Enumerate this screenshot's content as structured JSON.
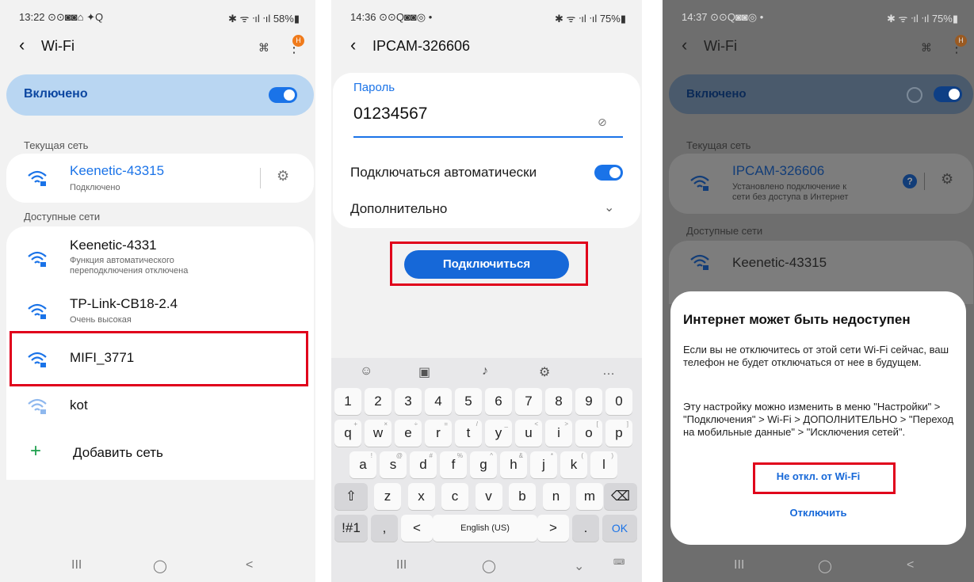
{
  "panel1": {
    "status_time": "13:22 ⊙⊙◙◙⌂ ✦Q",
    "status_right": "✱ ᯤ ᐧıl ᐧıl 58%▮",
    "title": "Wi-Fi",
    "badge": "Н",
    "toggle_label": "Включено",
    "current_section": "Текущая сеть",
    "current_network": {
      "name": "Keenetic-43315",
      "status": "Подключено"
    },
    "available_section": "Доступные сети",
    "networks": [
      {
        "name": "Keenetic-4331",
        "sub": "Функция автоматического\nпереподключения отключена"
      },
      {
        "name": "TP-Link-CB18-2.4",
        "sub": "Очень высокая"
      },
      {
        "name": "MIFI_3771",
        "sub": ""
      },
      {
        "name": "kot",
        "sub": ""
      }
    ],
    "add_network": "Добавить сеть",
    "accent": "#1a73e8",
    "highlight": "#e0001b"
  },
  "panel2": {
    "status_time": "14:36 ⊙⊙Q◙◙◎ •",
    "status_right": "✱ ᯤ ᐧıl ᐧıl 75%▮",
    "title": "IPCAM-326606",
    "password_label": "Пароль",
    "password_value": "01234567",
    "auto_connect": "Подключаться автоматически",
    "advanced": "Дополнительно",
    "connect_button": "Подключиться",
    "keyboard": {
      "numbers": [
        "1",
        "2",
        "3",
        "4",
        "5",
        "6",
        "7",
        "8",
        "9",
        "0"
      ],
      "row1": [
        "q",
        "w",
        "e",
        "r",
        "t",
        "y",
        "u",
        "i",
        "o",
        "p"
      ],
      "row1_hints": [
        "+",
        "×",
        "÷",
        "=",
        "/",
        "_",
        "<",
        ">",
        "[",
        "]"
      ],
      "row2": [
        "a",
        "s",
        "d",
        "f",
        "g",
        "h",
        "j",
        "k",
        "l"
      ],
      "row2_hints": [
        "!",
        "@",
        "#",
        "%",
        "^",
        "&",
        "*",
        "(",
        ")"
      ],
      "row3": [
        "z",
        "x",
        "c",
        "v",
        "b",
        "n",
        "m"
      ],
      "bottom": {
        "sym": "!#1",
        "comma": ",",
        "left": "<",
        "space": "English (US)",
        "right": ">",
        "dot": ".",
        "ok": "OK"
      }
    }
  },
  "panel3": {
    "status_time": "14:37 ⊙⊙Q◙◙◎ •",
    "status_right": "✱ ᯤ ᐧıl ᐧıl 75%▮",
    "title": "Wi-Fi",
    "badge": "Н",
    "toggle_label": "Включено",
    "current_section": "Текущая сеть",
    "current_network": {
      "name": "IPCAM-326606",
      "status": "Установлено подключение к\nсети без доступа в Интернет"
    },
    "available_section": "Доступные сети",
    "network": "Keenetic-43315",
    "dialog": {
      "title": "Интернет может быть недоступен",
      "para1": "Если вы не отключитесь от этой сети Wi-Fi сейчас, ваш телефон не будет отключаться от нее в будущем.",
      "para2": "Эту настройку можно изменить в меню \"Настройки\" > \"Подключения\" > Wi-Fi > ДОПОЛНИТЕЛЬНО > \"Переход на мобильные данные\" > \"Исключения сетей\".",
      "keep_button": "Не откл. от Wi-Fi",
      "disconnect_button": "Отключить"
    }
  },
  "nav": {
    "recent": "III",
    "home": "◯",
    "back": "<"
  }
}
